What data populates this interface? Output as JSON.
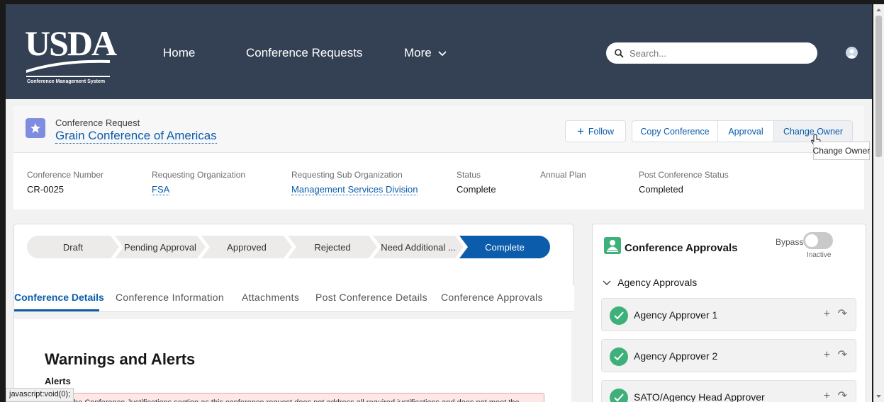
{
  "header": {
    "logo": {
      "text": "USDA",
      "subtitle": "Conference Management System"
    },
    "nav": [
      {
        "label": "Home"
      },
      {
        "label": "Conference Requests"
      },
      {
        "label": "More"
      }
    ],
    "search": {
      "placeholder": "Search..."
    },
    "avatar_icon": "user-avatar-icon"
  },
  "record": {
    "type_label": "Conference Request",
    "title": "Grain Conference of Americas",
    "actions": {
      "follow": "Follow",
      "copy": "Copy Conference",
      "approval": "Approval",
      "change_owner": "Change Owner"
    },
    "fields": [
      {
        "label": "Conference Number",
        "value": "CR-0025"
      },
      {
        "label": "Requesting Organization",
        "value": "FSA"
      },
      {
        "label": "Requesting Sub Organization",
        "value": "Management Services Division"
      },
      {
        "label": "Status",
        "value": "Complete"
      },
      {
        "label": "Annual Plan",
        "value": ""
      },
      {
        "label": "Post Conference Status",
        "value": "Completed"
      }
    ]
  },
  "tooltip": "Change Owner",
  "path": {
    "steps": [
      "Draft",
      "Pending Approval",
      "Approved",
      "Rejected",
      "Need Additional ...",
      "Complete"
    ],
    "current": "Complete"
  },
  "tabs": [
    {
      "label": "Conference Details",
      "active": true
    },
    {
      "label": "Conference Information",
      "active": false
    },
    {
      "label": "Attachments",
      "active": false
    },
    {
      "label": "Post Conference Details",
      "active": false
    },
    {
      "label": "Conference Approvals",
      "active": false
    }
  ],
  "details": {
    "heading": "Warnings and Alerts",
    "alerts_label": "Alerts",
    "alert_text": "the Conference Justifications section as this conference request does not address all required justifications and does not meet the"
  },
  "status_bar": "javascript:void(0);",
  "approvals": {
    "title": "Conference Approvals",
    "bypass_label": "Bypass",
    "bypass_state": "Inactive",
    "section": "Agency Approvals",
    "rows": [
      {
        "name": "Agency Approver 1"
      },
      {
        "name": "Agency Approver 2"
      },
      {
        "name": "SATO/Agency Head Approver"
      }
    ]
  },
  "colors": {
    "header_bg": "#344154",
    "brand_blue": "#0b5cab",
    "success_green": "#3eb17a",
    "path_active": "#0b5cab"
  }
}
